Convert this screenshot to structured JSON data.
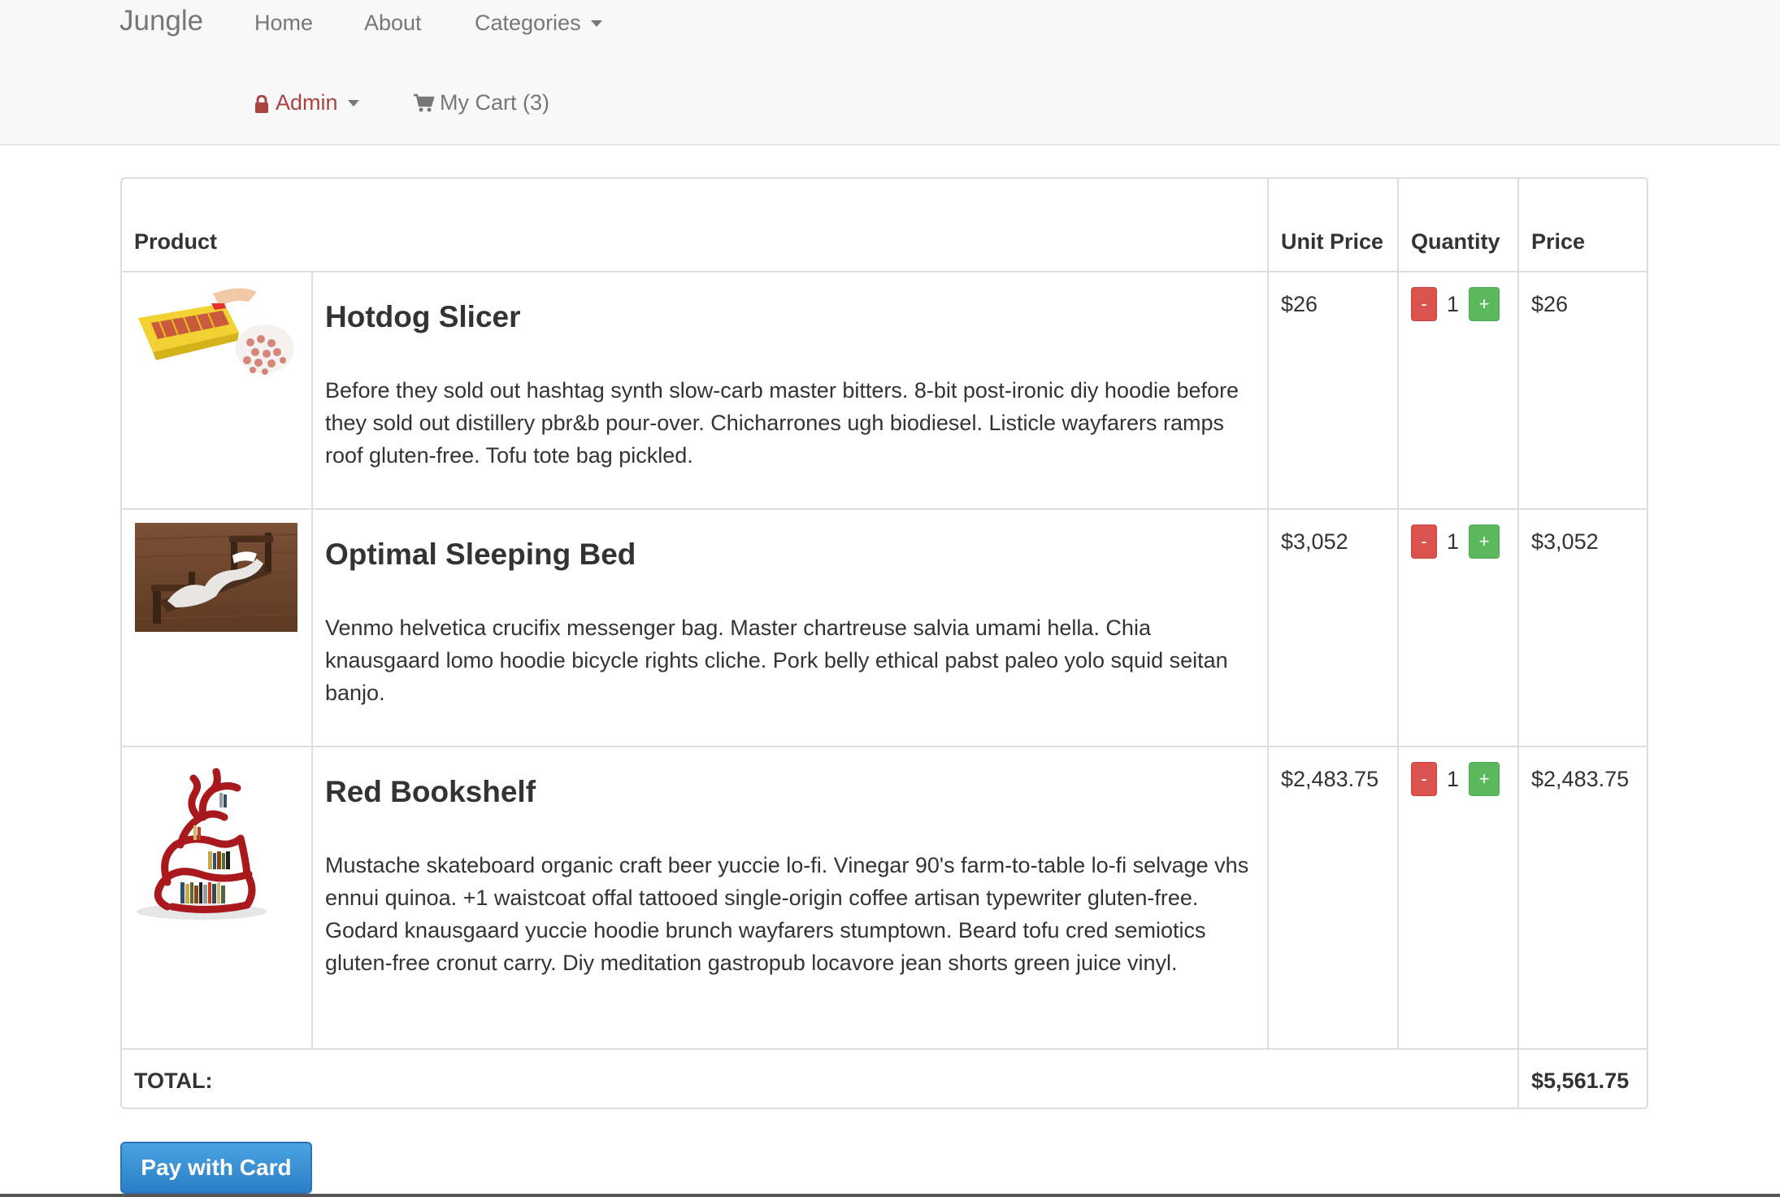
{
  "navbar": {
    "brand": "Jungle",
    "links": {
      "home": "Home",
      "about": "About",
      "categories": "Categories",
      "admin": "Admin",
      "cart": "My Cart (3)"
    }
  },
  "table": {
    "headers": {
      "product": "Product",
      "unit_price": "Unit Price",
      "quantity": "Quantity",
      "price": "Price"
    },
    "rows": [
      {
        "name": "Hotdog Slicer",
        "description": "Before they sold out hashtag synth slow-carb master bitters. 8-bit post-ironic diy hoodie before they sold out distillery pbr&b pour-over. Chicharrones ugh biodiesel. Listicle wayfarers ramps roof gluten-free. Tofu tote bag pickled.",
        "unit_price": "$26",
        "quantity": "1",
        "price": "$26"
      },
      {
        "name": "Optimal Sleeping Bed",
        "description": "Venmo helvetica crucifix messenger bag. Master chartreuse salvia umami hella. Chia knausgaard lomo hoodie bicycle rights cliche. Pork belly ethical pabst paleo yolo squid seitan banjo.",
        "unit_price": "$3,052",
        "quantity": "1",
        "price": "$3,052"
      },
      {
        "name": "Red Bookshelf",
        "description": "Mustache skateboard organic craft beer yuccie lo-fi. Vinegar 90's farm-to-table lo-fi selvage vhs ennui quinoa. +1 waistcoat offal tattooed single-origin coffee artisan typewriter gluten-free. Godard knausgaard yuccie hoodie brunch wayfarers stumptown. Beard tofu cred semiotics gluten-free cronut carry. Diy meditation gastropub locavore jean shorts green juice vinyl.",
        "unit_price": "$2,483.75",
        "quantity": "1",
        "price": "$2,483.75"
      }
    ],
    "minus_label": "-",
    "plus_label": "+",
    "total_label": "TOTAL:",
    "total_value": "$5,561.75"
  },
  "pay_button": "Pay with Card",
  "colors": {
    "danger": "#d9534f",
    "success": "#5cb85c",
    "admin_text": "#a94442",
    "pay_button": "#2b7fc8"
  },
  "icons": [
    "lock-icon",
    "cart-icon",
    "caret-down-icon"
  ]
}
